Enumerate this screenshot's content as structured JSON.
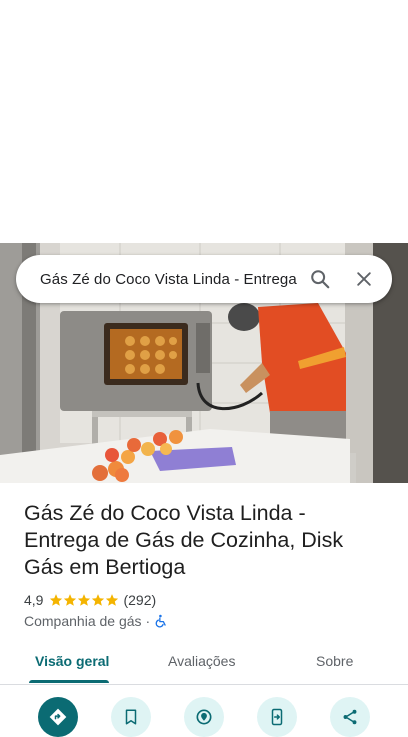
{
  "search": {
    "query": "Gás Zé do Coco Vista Linda - Entrega de Gás de Cozinha, Disk Gás em Bertioga"
  },
  "place": {
    "title": "Gás Zé do Coco Vista Linda - Entrega de Gás de Cozinha, Disk Gás em Bertioga",
    "rating": "4,9",
    "stars": 5,
    "review_count": "(292)",
    "category": "Companhia de gás",
    "separator": "·"
  },
  "tabs": [
    {
      "label": "Visão geral",
      "active": true
    },
    {
      "label": "Avaliações",
      "active": false
    },
    {
      "label": "Sobre",
      "active": false
    }
  ],
  "icons": {
    "search": "search-icon",
    "close": "close-icon",
    "accessibility": "wheelchair-icon",
    "actions": [
      "directions-icon",
      "bookmark-icon",
      "nearby-icon",
      "send-to-phone-icon",
      "share-icon"
    ]
  },
  "colors": {
    "accent": "#0b6b73",
    "action_bg": "#dff4f4",
    "star": "#f4b400",
    "accessibility": "#1a73e8"
  }
}
